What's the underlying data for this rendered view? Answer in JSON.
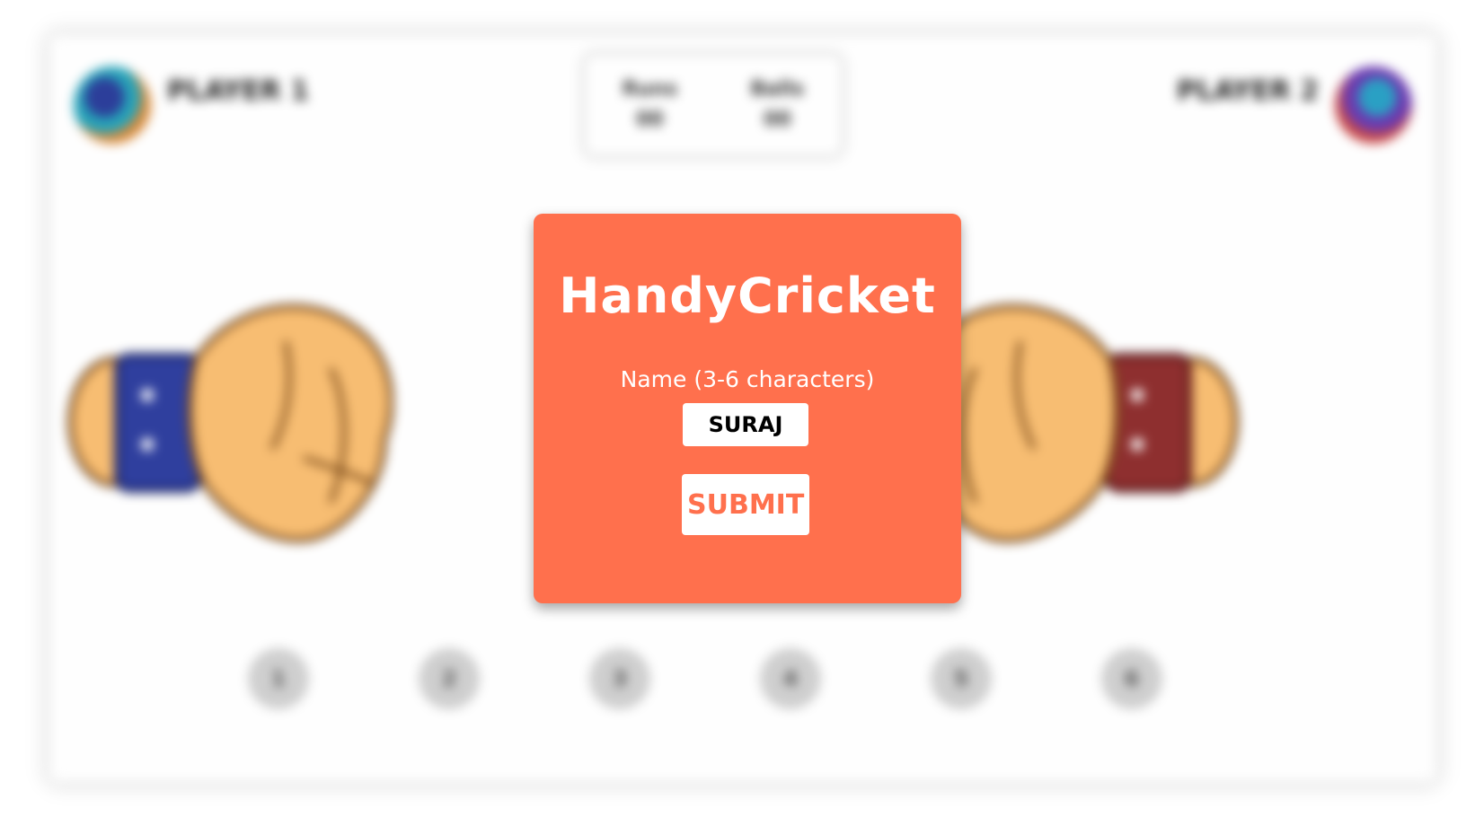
{
  "game": {
    "player_1": {
      "name": "PLAYER 1",
      "avatar_icon": "player-1-avatar"
    },
    "player_2": {
      "name": "PLAYER 2",
      "avatar_icon": "player-2-avatar"
    },
    "scoreboard": {
      "col_1": {
        "label": "Runs",
        "value": "00"
      },
      "col_2": {
        "label": "Balls",
        "value": "00"
      }
    },
    "run_buttons": [
      "1",
      "2",
      "3",
      "4",
      "5",
      "6"
    ],
    "colors": {
      "left_band": "#2f3f9e",
      "right_band": "#8e2f2f",
      "skin": "#f7bd72"
    }
  },
  "modal": {
    "title": "HandyCricket",
    "name_label": "Name (3-6 characters)",
    "name_value": "SURAJ",
    "submit_label": "SUBMIT",
    "background": "#ff704d"
  }
}
